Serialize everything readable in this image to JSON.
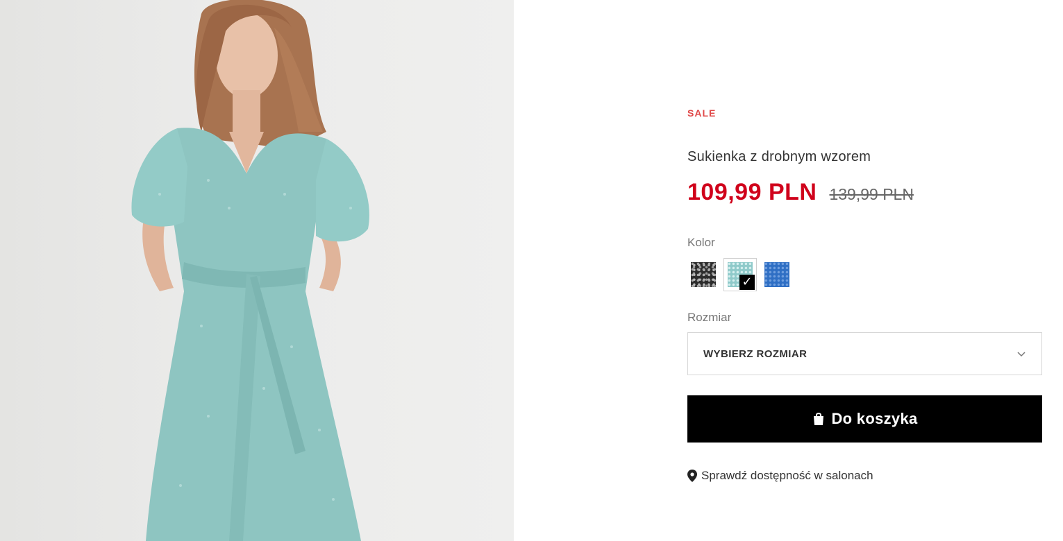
{
  "product": {
    "badge": "SALE",
    "title": "Sukienka z drobnym wzorem",
    "price_current": "109,99 PLN",
    "price_old": "139,99 PLN"
  },
  "color": {
    "label": "Kolor",
    "swatches": [
      {
        "name": "dark-pattern",
        "color": "#2c2c2c",
        "selected": false
      },
      {
        "name": "mint-pattern",
        "color": "#8fcaca",
        "selected": true
      },
      {
        "name": "blue-pattern",
        "color": "#2f6fc4",
        "selected": false
      }
    ]
  },
  "size": {
    "label": "Rozmiar",
    "placeholder": "WYBIERZ ROZMIAR"
  },
  "cart": {
    "button_label": "Do koszyka",
    "icon": "shopping-bag-icon"
  },
  "availability": {
    "label": "Sprawdź dostępność w salonach",
    "icon": "map-pin-icon"
  },
  "colors": {
    "sale_red": "#e04848",
    "price_red": "#d0021b",
    "button_bg": "#000000"
  }
}
